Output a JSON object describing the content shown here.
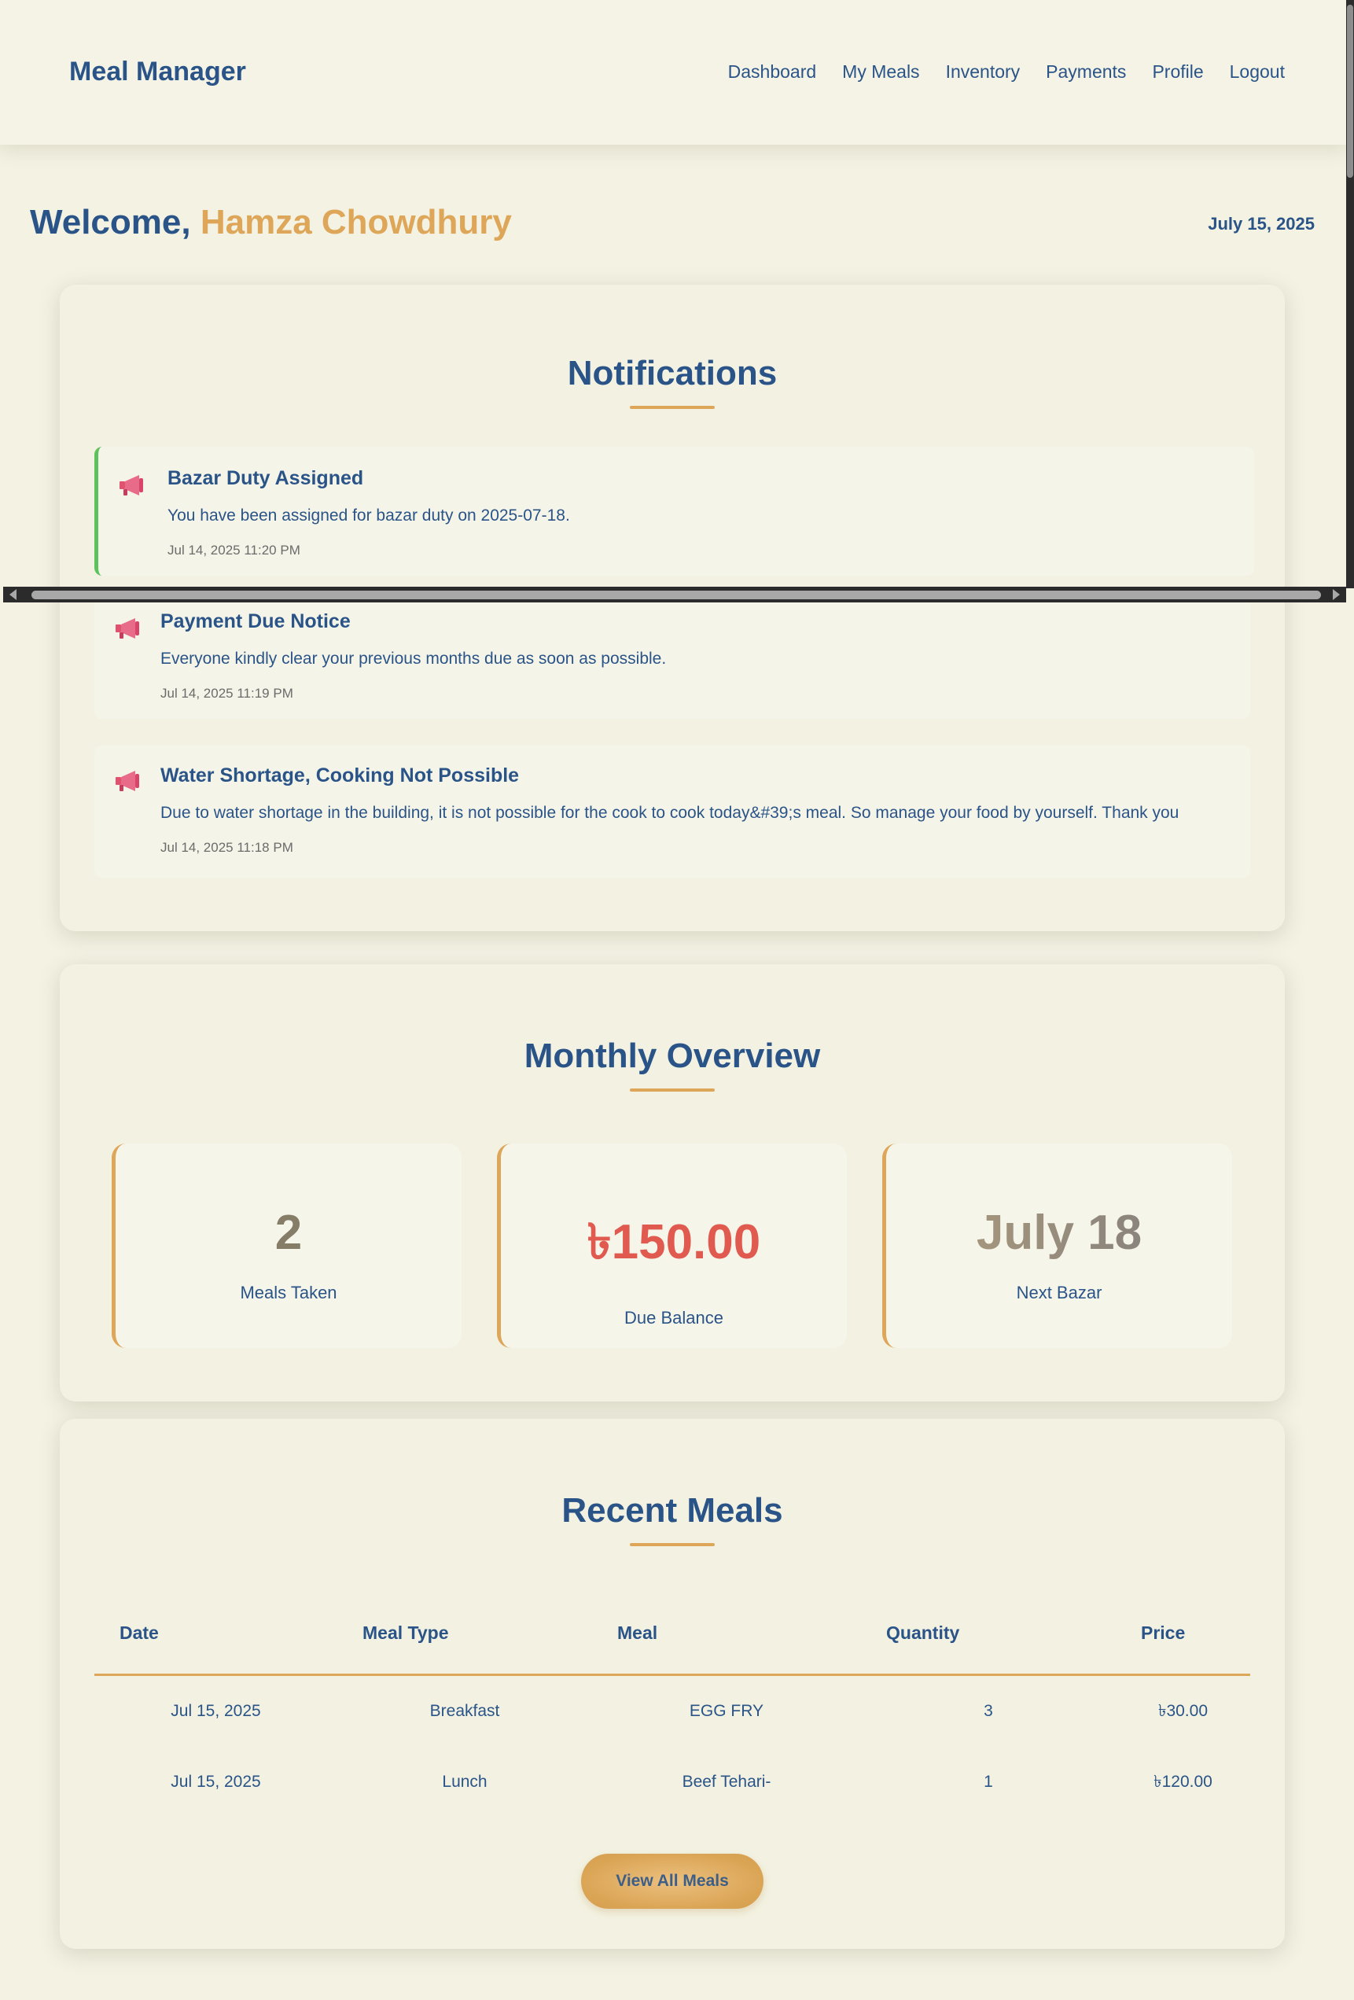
{
  "header": {
    "brand": "Meal Manager",
    "nav": [
      "Dashboard",
      "My Meals",
      "Inventory",
      "Payments",
      "Profile",
      "Logout"
    ]
  },
  "welcome": {
    "greeting": "Welcome,",
    "user_name": "Hamza Chowdhury",
    "date": "July 15, 2025"
  },
  "notifications": {
    "title": "Notifications",
    "items": [
      {
        "title": "Bazar Duty Assigned",
        "message": "You have been assigned for bazar duty on 2025-07-18.",
        "time": "Jul 14, 2025 11:20 PM",
        "icon": "megaphone-icon"
      },
      {
        "title": "Payment Due Notice",
        "message": "Everyone kindly clear your previous months due as soon as possible.",
        "time": "Jul 14, 2025 11:19 PM",
        "icon": "megaphone-icon"
      },
      {
        "title": "Water Shortage, Cooking Not Possible",
        "message": "Due to water shortage in the building, it is not possible for the cook to cook today&#39;s meal. So manage your food by yourself. Thank you",
        "time": "Jul 14, 2025 11:18 PM",
        "icon": "megaphone-icon"
      }
    ]
  },
  "overview": {
    "title": "Monthly Overview",
    "stats": [
      {
        "value": "2",
        "label": "Meals Taken"
      },
      {
        "value": "৳150.00",
        "label": "Due Balance"
      },
      {
        "value": "July 18",
        "label": "Next Bazar"
      }
    ]
  },
  "recent_meals": {
    "title": "Recent Meals",
    "columns": [
      "Date",
      "Meal Type",
      "Meal",
      "Quantity",
      "Price"
    ],
    "rows": [
      [
        "Jul 15, 2025",
        "Breakfast",
        "EGG FRY",
        "3",
        "৳30.00"
      ],
      [
        "Jul 15, 2025",
        "Lunch",
        "Beef Tehari-",
        "1",
        "৳120.00"
      ]
    ],
    "button": "View All Meals"
  },
  "colors": {
    "primary": "#2a5488",
    "accent": "#dda658",
    "background": "#f3f2e3",
    "due": "#e05a4f",
    "notification_active": "#5cc25c"
  }
}
